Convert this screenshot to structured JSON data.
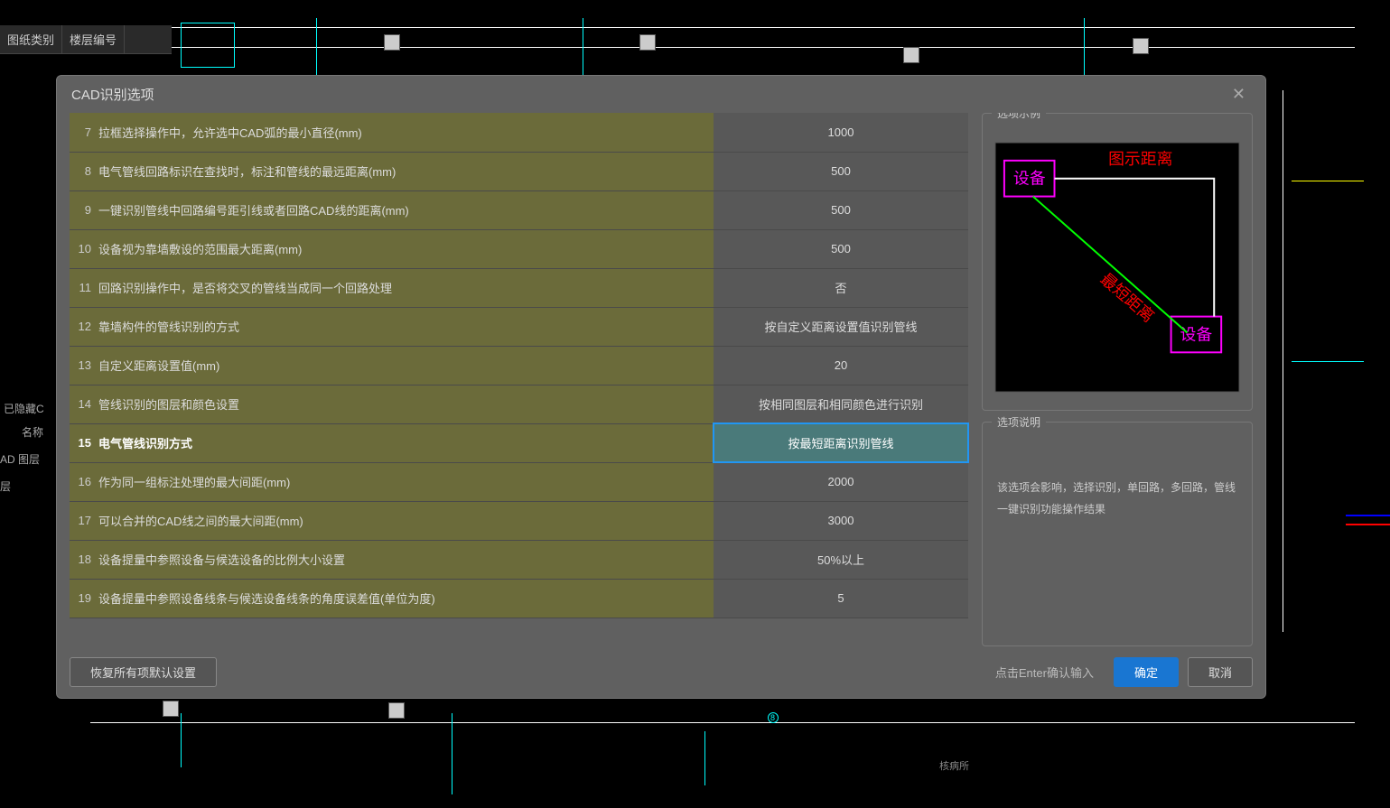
{
  "left_panel": {
    "col1": "图纸类别",
    "col2": "楼层编号",
    "hidden": "已隐藏C",
    "name": "名称",
    "cad_layer": "AD 图层",
    "layer": "层"
  },
  "dialog": {
    "title": "CAD识别选项",
    "example_title": "选项示例",
    "desc_title": "选项说明",
    "desc_text": "该选项会影响，选择识别，单回路，多回路，管线一键识别功能操作结果",
    "restore_btn": "恢复所有项默认设置",
    "hint": "点击Enter确认输入",
    "ok_btn": "确定",
    "cancel_btn": "取消"
  },
  "example": {
    "device1": "设备",
    "device2": "设备",
    "label1": "图示距离",
    "label2": "最短距离"
  },
  "rows": [
    {
      "n": "7",
      "label": "拉框选择操作中，允许选中CAD弧的最小直径(mm)",
      "value": "1000"
    },
    {
      "n": "8",
      "label": "电气管线回路标识在查找时，标注和管线的最远距离(mm)",
      "value": "500"
    },
    {
      "n": "9",
      "label": "一键识别管线中回路编号距引线或者回路CAD线的距离(mm)",
      "value": "500"
    },
    {
      "n": "10",
      "label": "设备视为靠墙敷设的范围最大距离(mm)",
      "value": "500"
    },
    {
      "n": "11",
      "label": "回路识别操作中，是否将交叉的管线当成同一个回路处理",
      "value": "否"
    },
    {
      "n": "12",
      "label": "靠墙构件的管线识别的方式",
      "value": "按自定义距离设置值识别管线"
    },
    {
      "n": "13",
      "label": "自定义距离设置值(mm)",
      "value": "20"
    },
    {
      "n": "14",
      "label": "管线识别的图层和颜色设置",
      "value": "按相同图层和相同颜色进行识别"
    },
    {
      "n": "15",
      "label": "电气管线识别方式",
      "value": "按最短距离识别管线",
      "selected": true
    },
    {
      "n": "16",
      "label": "作为同一组标注处理的最大间距(mm)",
      "value": "2000"
    },
    {
      "n": "17",
      "label": "可以合并的CAD线之间的最大间距(mm)",
      "value": "3000"
    },
    {
      "n": "18",
      "label": "设备提量中参照设备与候选设备的比例大小设置",
      "value": "50%以上"
    },
    {
      "n": "19",
      "label": "设备提量中参照设备线条与候选设备线条的角度误差值(单位为度)",
      "value": "5"
    }
  ]
}
